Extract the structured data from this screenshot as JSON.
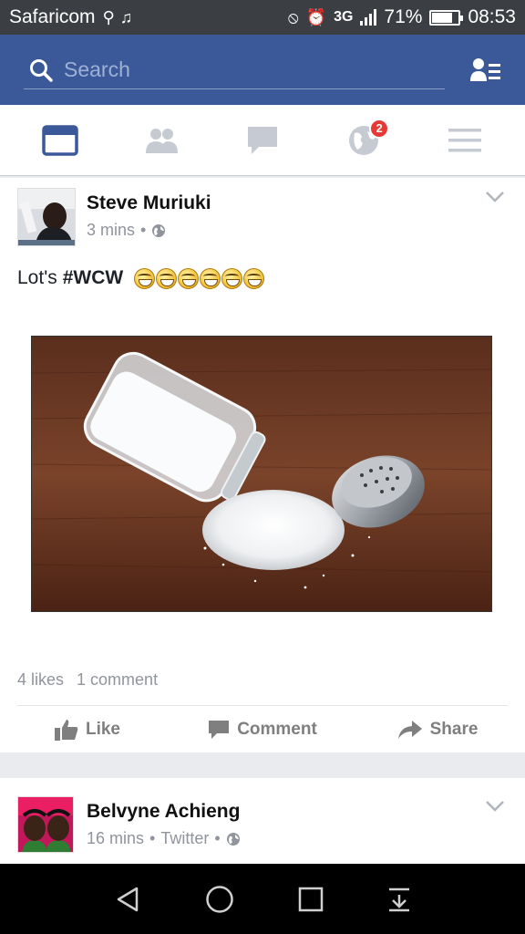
{
  "status_bar": {
    "carrier": "Safaricom",
    "network": "3G",
    "battery": "71%",
    "time": "08:53"
  },
  "search": {
    "placeholder": "Search"
  },
  "nav": {
    "notifications_badge": "2"
  },
  "posts": [
    {
      "author": "Steve Muriuki",
      "time": "3 mins",
      "text_prefix": "Lot's",
      "hashtag": "#WCW",
      "emoji_count": 6,
      "likes": "4 likes",
      "comments": "1 comment",
      "actions": {
        "like": "Like",
        "comment": "Comment",
        "share": "Share"
      }
    },
    {
      "author": "Belvyne Achieng",
      "time": "16 mins",
      "source": "Twitter"
    }
  ],
  "colors": {
    "brand": "#3b5998",
    "badge": "#e53935",
    "meta_text": "#90949c"
  }
}
